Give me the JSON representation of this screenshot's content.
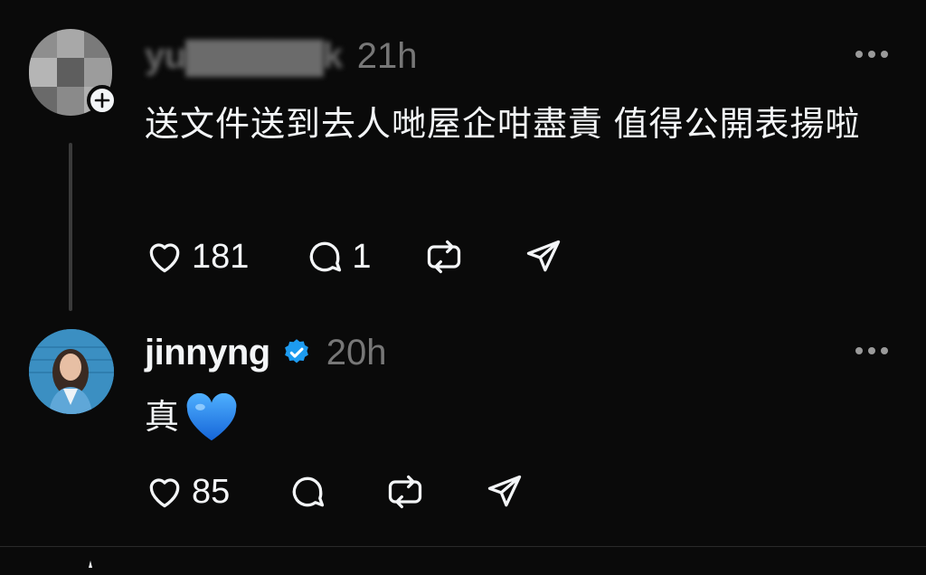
{
  "posts": [
    {
      "username": "yu▇▇▇▇▇k",
      "time": "21h",
      "text": "送文件送到去人哋屋企咁盡責 值得公開表揚啦",
      "likes": "181",
      "replies": "1",
      "avatar": "pixelated-avatar",
      "badge_icon": "plus-icon"
    },
    {
      "username": "jinnyng",
      "time": "20h",
      "text": "真",
      "emoji": "blue-heart-icon",
      "likes": "85",
      "verified_icon": "verified-badge-icon"
    }
  ],
  "icons": {
    "like": "heart-outline-icon",
    "reply": "speech-bubble-icon",
    "repost": "repost-icon",
    "share": "paper-plane-icon",
    "more": "more-horizontal-icon"
  },
  "colors": {
    "background": "#0a0a0a",
    "text": "#f3f5f7",
    "muted": "#777777",
    "verified": "#1d9bf0",
    "emoji_heart": "#1e90ff"
  }
}
